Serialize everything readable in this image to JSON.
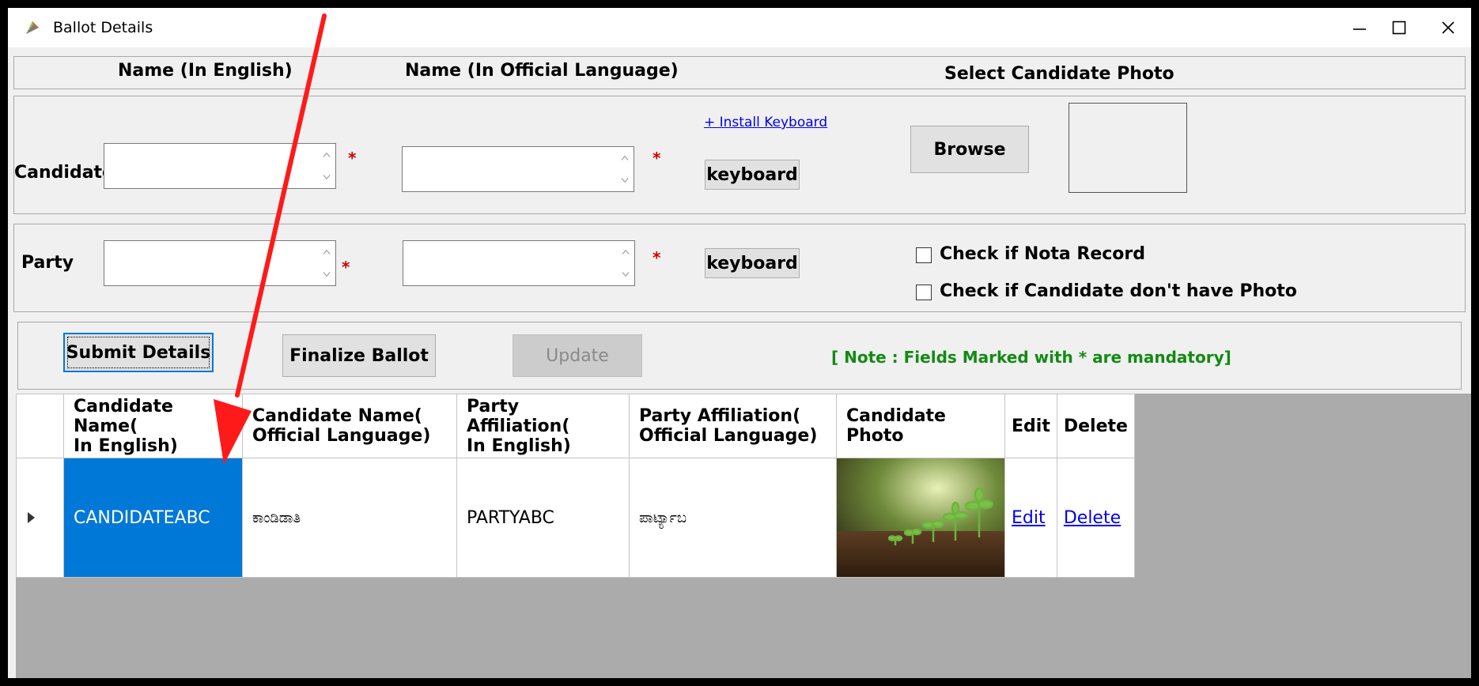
{
  "window": {
    "title": "Ballot Details",
    "controls": {
      "minimize": "minimize-icon",
      "maximize": "maximize-icon",
      "close": "close-icon"
    }
  },
  "column_headers": {
    "english": "Name (In English)",
    "official": "Name (In Official Language)",
    "photo": "Select Candidate Photo"
  },
  "candidate_row": {
    "label": "Candidate",
    "english_value": "",
    "official_value": "",
    "install_keyboard_link": "+ Install Keyboard",
    "keyboard_button": "keyboard",
    "browse_button": "Browse",
    "required_mark": "*"
  },
  "party_row": {
    "label": "Party",
    "english_value": "",
    "official_value": "",
    "keyboard_button": "keyboard",
    "required_mark": "*"
  },
  "checkboxes": {
    "nota": {
      "label": "Check if Nota Record",
      "checked": false
    },
    "no_photo": {
      "label": "Check if Candidate don't have Photo",
      "checked": false
    }
  },
  "actions": {
    "submit": "Submit Details",
    "finalize": "Finalize Ballot",
    "update": "Update",
    "note": "[ Note : Fields Marked with * are mandatory]"
  },
  "grid": {
    "headers": {
      "cand_en_1": "Candidate Name(",
      "cand_en_2": "In English)",
      "cand_ol_1": "Candidate Name(",
      "cand_ol_2": "Official Language)",
      "party_en_1": "Party Affiliation(",
      "party_en_2": "In English)",
      "party_ol_1": "Party Affiliation(",
      "party_ol_2": "Official Language)",
      "photo_1": "Candidate",
      "photo_2": "Photo",
      "edit": "Edit",
      "delete": "Delete"
    },
    "rows": [
      {
        "candidate_en": "CANDIDATEABC",
        "candidate_ol": "ಕಾಂಡಿಡಾತಿ",
        "party_en": "PARTYABC",
        "party_ol": "ಪಾರ್ಟ್ಯಾಬ",
        "photo": "seedlings-in-soil",
        "edit": "Edit",
        "delete": "Delete"
      }
    ]
  },
  "colors": {
    "selection": "#0078d7",
    "annotation_arrow": "#ff0000",
    "note": "#138a13",
    "required": "#d10000"
  }
}
